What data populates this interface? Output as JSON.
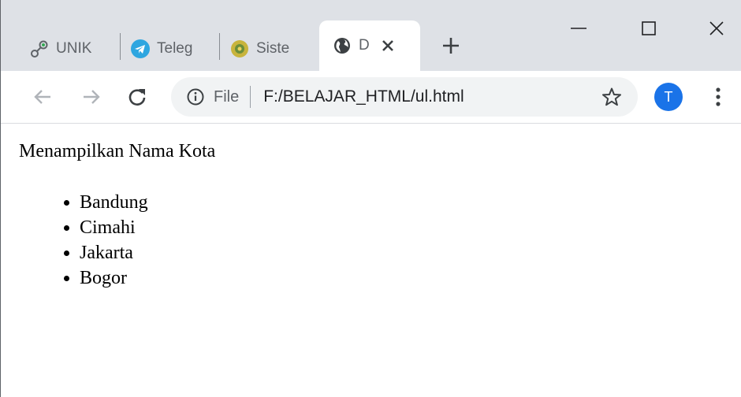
{
  "tabs": [
    {
      "title": "UNIK",
      "icon": "link-icon",
      "active": false
    },
    {
      "title": "Teleg",
      "icon": "telegram-icon",
      "active": false
    },
    {
      "title": "Siste",
      "icon": "emblem-icon",
      "active": false
    },
    {
      "title": "D",
      "icon": "globe-icon",
      "active": true
    }
  ],
  "toolbar": {
    "scheme_label": "File",
    "url": "F:/BELAJAR_HTML/ul.html",
    "profile_initial": "T"
  },
  "page": {
    "heading": "Menampilkan Nama Kota",
    "cities": [
      "Bandung",
      "Cimahi",
      "Jakarta",
      "Bogor"
    ]
  },
  "colors": {
    "tabstrip_bg": "#dee1e6",
    "omnibox_bg": "#f1f3f4",
    "profile_bg": "#1a73e8",
    "telegram_blue": "#2ea6e0"
  }
}
